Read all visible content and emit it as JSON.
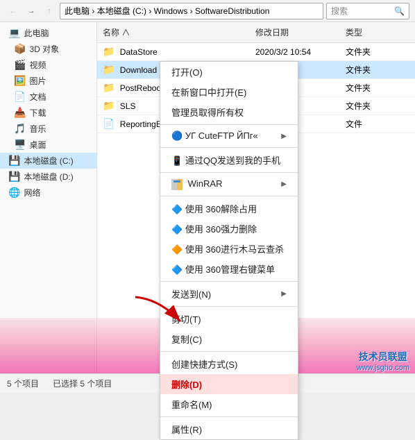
{
  "titlebar": {
    "back_label": "←",
    "forward_label": "→",
    "up_label": "↑",
    "path": "此电脑 › 本地磁盘 (C:) › Windows › SoftwareDistribution",
    "path_segments": [
      "此电脑",
      "本地磁盘 (C:)",
      "Windows",
      "SoftwareDistribution"
    ],
    "search_placeholder": "搜索"
  },
  "sidebar": {
    "items": [
      {
        "id": "this-pc",
        "label": "此电脑",
        "icon": "💻",
        "active": false
      },
      {
        "id": "3d-objects",
        "label": "3D 对象",
        "icon": "📦",
        "active": false
      },
      {
        "id": "video",
        "label": "视频",
        "icon": "🎬",
        "active": false
      },
      {
        "id": "pictures",
        "label": "图片",
        "icon": "🖼️",
        "active": false
      },
      {
        "id": "documents",
        "label": "文档",
        "icon": "📄",
        "active": false
      },
      {
        "id": "downloads",
        "label": "下载",
        "icon": "📥",
        "active": false
      },
      {
        "id": "music",
        "label": "音乐",
        "icon": "🎵",
        "active": false
      },
      {
        "id": "desktop",
        "label": "桌面",
        "icon": "🖥️",
        "active": false
      },
      {
        "id": "local-c",
        "label": "本地磁盘 (C:)",
        "icon": "💾",
        "active": true
      },
      {
        "id": "local-d",
        "label": "本地磁盘 (D:)",
        "icon": "💾",
        "active": false
      },
      {
        "id": "network",
        "label": "网络",
        "icon": "🌐",
        "active": false
      }
    ]
  },
  "file_list": {
    "columns": [
      "名称",
      "修改日期",
      "类型"
    ],
    "files": [
      {
        "name": "DataStore",
        "date": "2020/3/2 10:54",
        "type": "文件夹",
        "icon": "📁",
        "selected": false
      },
      {
        "name": "Download",
        "date": "",
        "type": "文件夹",
        "icon": "📁",
        "selected": true
      },
      {
        "name": "PostRebootEv...",
        "date": "",
        "type": "文件夹",
        "icon": "📁",
        "selected": false
      },
      {
        "name": "SLS",
        "date": "",
        "type": "文件夹",
        "icon": "📁",
        "selected": false
      },
      {
        "name": "ReportingEve...",
        "date": "",
        "type": "文件",
        "icon": "📄",
        "selected": false
      }
    ]
  },
  "context_menu": {
    "items": [
      {
        "id": "open",
        "label": "打开(O)",
        "icon": "",
        "has_submenu": false,
        "style": "normal"
      },
      {
        "id": "open-new-window",
        "label": "在新窗口中打开(E)",
        "icon": "",
        "has_submenu": false,
        "style": "normal"
      },
      {
        "id": "take-ownership",
        "label": "管理员取得所有权",
        "icon": "",
        "has_submenu": false,
        "style": "normal"
      },
      {
        "id": "divider1",
        "type": "divider"
      },
      {
        "id": "cuteftp",
        "label": "УГ CuteFTP ЙПг«",
        "icon": "🔵",
        "has_submenu": true,
        "style": "normal"
      },
      {
        "id": "divider2",
        "type": "divider"
      },
      {
        "id": "send-to-phone",
        "label": "通过QQ发送到我的手机",
        "icon": "📱",
        "has_submenu": false,
        "style": "normal"
      },
      {
        "id": "divider3",
        "type": "divider"
      },
      {
        "id": "winrar",
        "label": "WinRAR",
        "icon": "📦",
        "has_submenu": true,
        "style": "normal"
      },
      {
        "id": "divider4",
        "type": "divider"
      },
      {
        "id": "360-unlock",
        "label": "使用 360解除占用",
        "icon": "🔷",
        "has_submenu": false,
        "style": "normal"
      },
      {
        "id": "360-delete",
        "label": "使用 360强力删除",
        "icon": "🔷",
        "has_submenu": false,
        "style": "normal"
      },
      {
        "id": "360-virus",
        "label": "使用 360进行木马云查杀",
        "icon": "🔶",
        "has_submenu": false,
        "style": "normal"
      },
      {
        "id": "360-menu",
        "label": "使用 360管理右键菜单",
        "icon": "🔷",
        "has_submenu": false,
        "style": "normal"
      },
      {
        "id": "divider5",
        "type": "divider"
      },
      {
        "id": "send-to",
        "label": "发送到(N)",
        "icon": "",
        "has_submenu": true,
        "style": "normal"
      },
      {
        "id": "divider6",
        "type": "divider"
      },
      {
        "id": "cut",
        "label": "剪切(T)",
        "icon": "",
        "has_submenu": false,
        "style": "normal"
      },
      {
        "id": "copy",
        "label": "复制(C)",
        "icon": "",
        "has_submenu": false,
        "style": "normal"
      },
      {
        "id": "divider7",
        "type": "divider"
      },
      {
        "id": "create-shortcut",
        "label": "创建快捷方式(S)",
        "icon": "",
        "has_submenu": false,
        "style": "normal"
      },
      {
        "id": "delete",
        "label": "删除(D)",
        "icon": "",
        "has_submenu": false,
        "style": "red"
      },
      {
        "id": "rename",
        "label": "重命名(M)",
        "icon": "",
        "has_submenu": false,
        "style": "normal"
      },
      {
        "id": "divider8",
        "type": "divider"
      },
      {
        "id": "properties",
        "label": "属性(R)",
        "icon": "",
        "has_submenu": false,
        "style": "normal"
      }
    ]
  },
  "statusbar": {
    "item_count": "5 个项目",
    "selected_count": "已选择 5 个项目"
  },
  "watermark": {
    "line1": "技术员联盟",
    "line2": "www.jsgho.com"
  }
}
